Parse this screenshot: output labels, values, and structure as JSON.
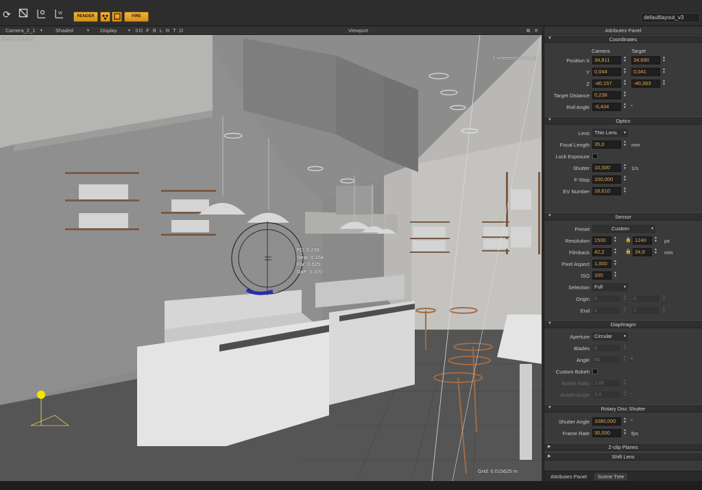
{
  "toolbar": {
    "icons": [
      "refresh-icon",
      "crop-icon",
      "pivot-icon",
      "world-icon"
    ],
    "render_label": "RENDER",
    "fire_label": "FIRE",
    "layout_value": "defaultlayout_v3"
  },
  "viewport_header": {
    "camera": "Camera_2_1",
    "shading": "Shaded",
    "display": "Display",
    "view_modes": "3D F B L R T D",
    "title": "Viewport"
  },
  "viewport": {
    "hint": "Select objects",
    "selection_info": "1 selected cameras",
    "focus_readout": [
      "FD: 0.238",
      "Near: 0.154",
      "Far: 0.525",
      "DoF: 0.370"
    ],
    "grid_info": "Grid: 0.015625 m"
  },
  "panel": {
    "title": "Attributes Panel",
    "coordinates": {
      "title": "Coordinates",
      "col_camera": "Camera",
      "col_target": "Target",
      "position_x_label": "Position X",
      "y_label": "Y",
      "z_label": "Z",
      "target_distance_label": "Target Distance",
      "roll_angle_label": "Roll Angle",
      "pos_x_camera": "34,811",
      "pos_x_target": "34,690",
      "y_camera": "0,044",
      "y_target": "0,041",
      "z_camera": "-40,157",
      "z_target": "-40,363",
      "target_distance": "0,238",
      "roll_angle": "-0,434",
      "roll_unit": "°"
    },
    "optics": {
      "title": "Optics",
      "lens_label": "Lens",
      "lens_value": "Thin Lens",
      "focal_label": "Focal Length",
      "focal_value": "35,0",
      "focal_unit": "mm",
      "lock_exposure_label": "Lock Exposure",
      "shutter_label": "Shutter",
      "shutter_value": "10,000",
      "shutter_unit": "1/s",
      "fstop_label": "F-Stop",
      "fstop_value": "100,000",
      "ev_label": "EV Number",
      "ev_value": "16,610"
    },
    "sensor": {
      "title": "Sensor",
      "preset_label": "Preset",
      "preset_value": "Custom",
      "resolution_label": "Resolution",
      "res_w": "1500",
      "res_h": "1240",
      "res_unit": "px",
      "filmback_label": "Filmback",
      "film_w": "42,2",
      "film_h": "34,9",
      "film_unit": "mm",
      "pixel_aspect_label": "Pixel Aspect",
      "pixel_aspect": "1,000",
      "iso_label": "ISO",
      "iso_value": "100",
      "selection_label": "Selection",
      "selection_value": "Full",
      "origin_label": "Origin",
      "origin_x": "0",
      "origin_y": "0",
      "end_label": "End",
      "end_x": "1",
      "end_y": "1"
    },
    "diaphragm": {
      "title": "Diaphragm",
      "aperture_label": "Aperture",
      "aperture_value": "Circular",
      "blades_label": "Blades",
      "blades_value": "6",
      "angle_label": "Angle",
      "angle_value": "60",
      "angle_unit": "°",
      "custom_bokeh_label": "Custom Bokeh",
      "bokeh_ratio_label": "Bokeh Ratio",
      "bokeh_ratio_value": "1,00",
      "bokeh_angle_label": "Bokeh Angle",
      "bokeh_angle_value": "0,0",
      "bokeh_angle_unit": "°"
    },
    "rotary": {
      "title": "Rotary Disc Shutter",
      "shutter_angle_label": "Shutter Angle",
      "shutter_angle_value": "1080,000",
      "shutter_angle_unit": "°",
      "frame_rate_label": "Frame Rate",
      "frame_rate_value": "30,000",
      "frame_rate_unit": "fps"
    },
    "zclip_title": "Z-clip Planes",
    "shiftlens_title": "Shift Lens",
    "tabs": [
      "Attributes Panel",
      "Scene Tree"
    ]
  },
  "colors": {
    "accent_orange": "#e8a64a",
    "toolbar_button": "#f0b030",
    "viewport_bg": "#8a8a8a",
    "panel_bg": "#3a3a3a"
  }
}
